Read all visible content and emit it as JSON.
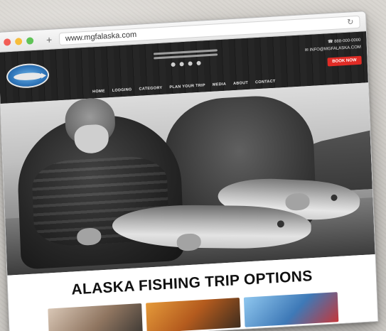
{
  "browser": {
    "url": "www.mgfalaska.com",
    "new_tab_symbol": "+",
    "reload_symbol": "↻"
  },
  "site": {
    "header": {
      "phone_1": "☎ 888-000-0000",
      "phone_2": "✉ INFO@MGFALASKA.COM",
      "book_label": "BOOK NOW"
    },
    "nav": [
      "HOME",
      "LODGING",
      "CATEGORY",
      "PLAN YOUR TRIP",
      "MEDIA",
      "ABOUT",
      "CONTACT"
    ],
    "section_title": "ALASKA FISHING TRIP OPTIONS"
  },
  "colors": {
    "accent": "#e02c26",
    "logo_blue": "#2f75b9"
  },
  "icons": [
    "close-dot",
    "minimize-dot",
    "maximize-dot",
    "plus-icon",
    "reload-icon"
  ]
}
